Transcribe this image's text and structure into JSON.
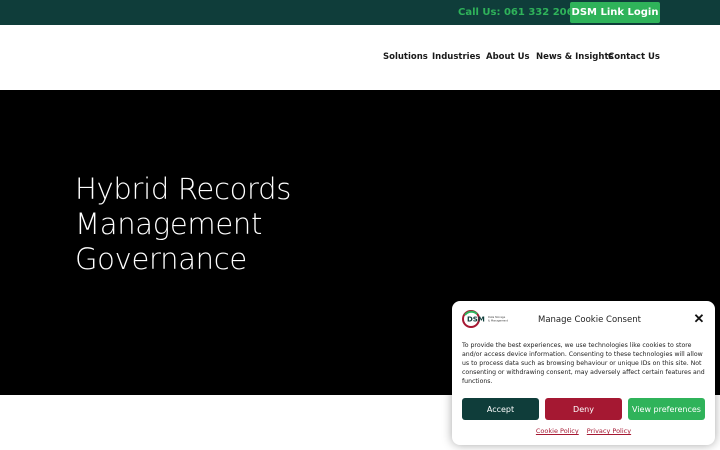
{
  "topbar": {
    "phone": "Call Us: 061 332 206",
    "login_label": "DSM Link Login"
  },
  "nav": {
    "items": [
      "Solutions",
      "Industries",
      "About Us",
      "News & Insights",
      "Contact Us"
    ]
  },
  "hero": {
    "title_line1": "Hybrid Records",
    "title_line2": "Management",
    "title_line3": "Governance"
  },
  "cookie": {
    "logo_text": "DSM",
    "logo_subtext": "Data Storage & Management",
    "title": "Manage Cookie Consent",
    "body": "To provide the best experiences, we use technologies like cookies to store and/or access device information. Consenting to these technologies will allow us to process data such as browsing behaviour or unique IDs on this site. Not consenting or withdrawing consent, may adversely affect certain features and functions.",
    "accept_label": "Accept",
    "deny_label": "Deny",
    "prefs_label": "View preferences",
    "cookie_policy_label": "Cookie Policy",
    "privacy_policy_label": "Privacy Policy"
  },
  "colors": {
    "brand_dark": "#0f3d3a",
    "brand_green": "#2fb35a",
    "deny_red": "#a51832"
  }
}
